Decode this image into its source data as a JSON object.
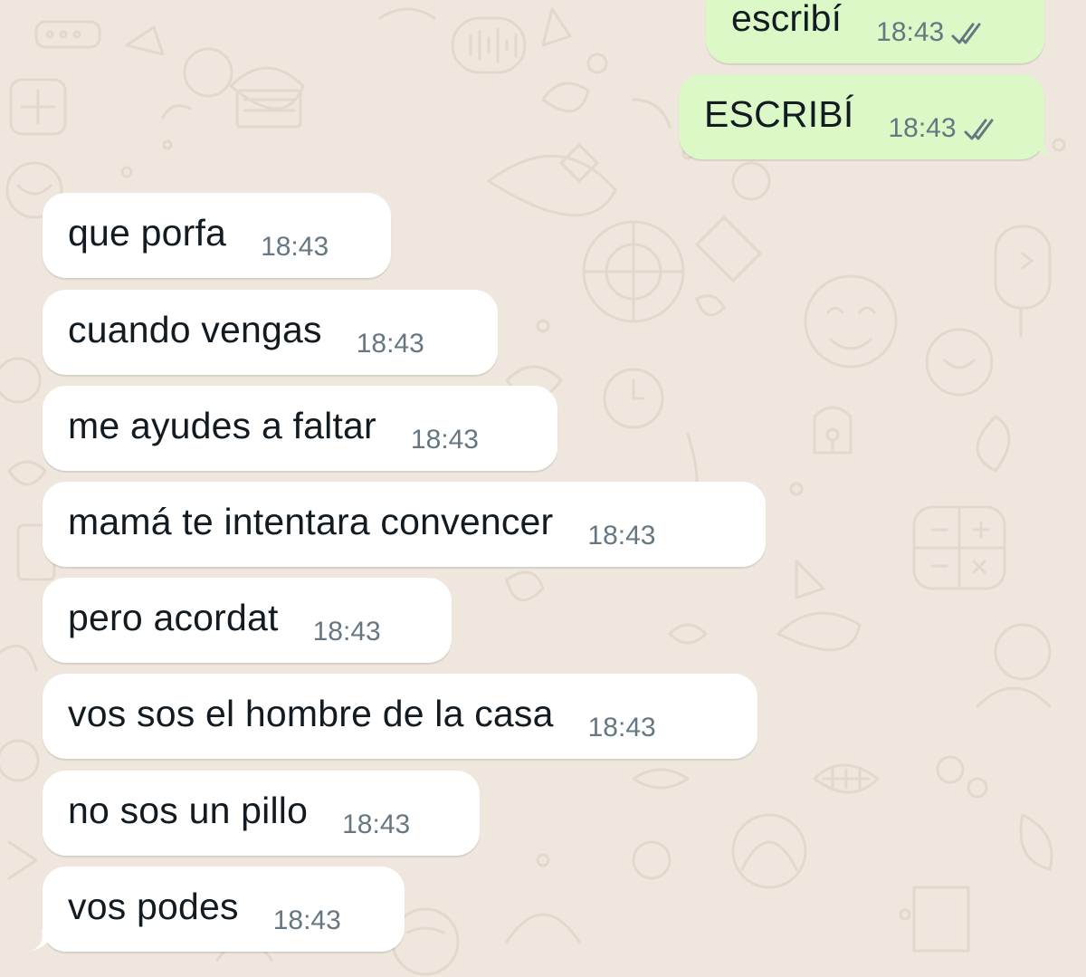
{
  "conversation": {
    "outgoing": [
      {
        "text": "escribí",
        "time": "18:43",
        "status_icon": "double-check-icon"
      },
      {
        "text": "ESCRIBÍ",
        "time": "18:43",
        "status_icon": "double-check-icon"
      }
    ],
    "incoming": [
      {
        "text": "que porfa",
        "time": "18:43"
      },
      {
        "text": "cuando vengas",
        "time": "18:43"
      },
      {
        "text": "me ayudes a faltar",
        "time": "18:43"
      },
      {
        "text": "mamá te intentara convencer",
        "time": "18:43"
      },
      {
        "text": "pero acordat",
        "time": "18:43"
      },
      {
        "text": "vos sos el hombre de la casa",
        "time": "18:43"
      },
      {
        "text": "no sos un pillo",
        "time": "18:43"
      },
      {
        "text": "vos podes",
        "time": "18:43"
      }
    ]
  },
  "theme": {
    "wallpaper": "#efe7dd",
    "wallpaper_doodle": "#e3d9cd",
    "incoming_bubble": "#ffffff",
    "outgoing_bubble": "#dbf8c6",
    "text": "#111b21",
    "timestamp": "#667781",
    "tick_read": "#667781"
  }
}
